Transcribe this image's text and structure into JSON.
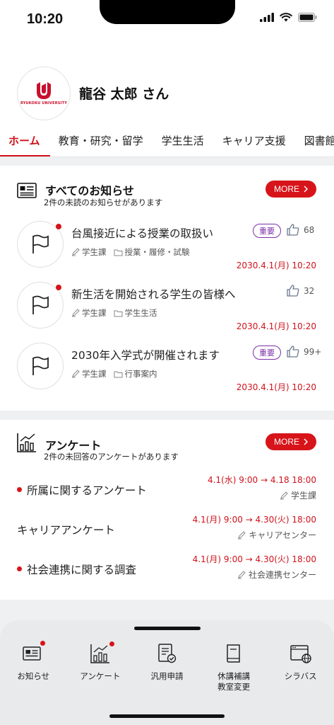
{
  "status_bar": {
    "time": "10:20"
  },
  "header": {
    "logo_text": "RYUKOKU UNIVERSITY",
    "user_name": "龍谷 太郎 さん",
    "tabs": [
      {
        "label": "ホーム",
        "active": true
      },
      {
        "label": "教育・研究・留学",
        "active": false
      },
      {
        "label": "学生生活",
        "active": false
      },
      {
        "label": "キャリア支援",
        "active": false
      },
      {
        "label": "図書館・",
        "active": false
      }
    ]
  },
  "notices": {
    "title": "すべてのお知らせ",
    "subtitle": "2件の未読のお知らせがあります",
    "more_label": "MORE",
    "items": [
      {
        "title": "台風接近による授業の取扱い",
        "unread": true,
        "badge": "重要",
        "likes": "68",
        "department": "学生課",
        "category": "授業・履修・試験",
        "date": "2030.4.1(月) 10:20"
      },
      {
        "title": "新生活を開始される学生の皆様へ",
        "unread": true,
        "badge": "",
        "likes": "32",
        "department": "学生課",
        "category": "学生生活",
        "date": "2030.4.1(月) 10:20"
      },
      {
        "title": "2030年入学式が開催されます",
        "unread": false,
        "badge": "重要",
        "likes": "99+",
        "department": "学生課",
        "category": "行事案内",
        "date": "2030.4.1(月) 10:20"
      }
    ]
  },
  "surveys": {
    "title": "アンケート",
    "subtitle": "2件の未回答のアンケートがあります",
    "more_label": "MORE",
    "items": [
      {
        "title": "所属に関するアンケート",
        "unanswered": true,
        "range": "4.1(水) 9:00 → 4.18 18:00",
        "owner": "学生課"
      },
      {
        "title": "キャリアアンケート",
        "unanswered": false,
        "range": "4.1(月) 9:00 → 4.30(火) 18:00",
        "owner": "キャリアセンター"
      },
      {
        "title": "社会連携に関する調査",
        "unanswered": true,
        "range": "4.1(月) 9:00 → 4.30(火) 18:00",
        "owner": "社会連携センター"
      }
    ]
  },
  "bottom_nav": {
    "items": [
      {
        "label": "お知らせ",
        "icon": "news-icon",
        "dot": true
      },
      {
        "label": "アンケート",
        "icon": "chart-icon",
        "dot": true
      },
      {
        "label": "汎用申請",
        "icon": "form-check-icon",
        "dot": false
      },
      {
        "label": "休講補講\n教室変更",
        "icon": "book-icon",
        "dot": false
      },
      {
        "label": "シラバス",
        "icon": "web-globe-icon",
        "dot": false
      }
    ]
  },
  "colors": {
    "accent": "#d7141a",
    "badge": "#7b2fa8",
    "nav_bg": "#e9eaec"
  }
}
